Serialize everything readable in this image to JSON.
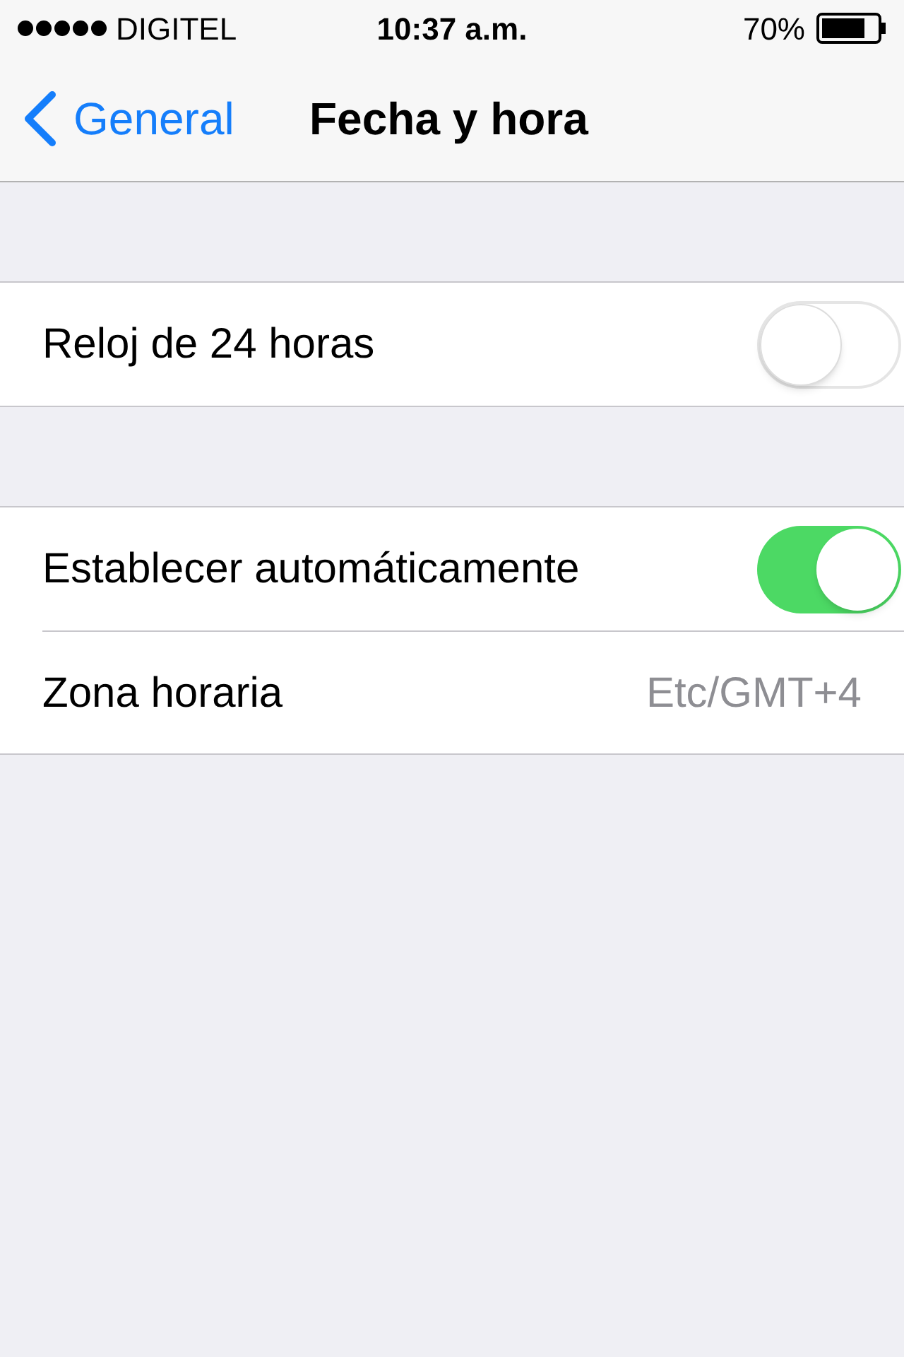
{
  "status_bar": {
    "carrier": "DIGITEL",
    "time": "10:37 a.m.",
    "battery": "70%"
  },
  "nav_bar": {
    "back": "General",
    "title": "Fecha y hora"
  },
  "sections": [
    {
      "rows": [
        {
          "kind": "toggle",
          "label": "Reloj de 24 horas",
          "on": false
        }
      ]
    },
    {
      "rows": [
        {
          "kind": "toggle",
          "label": "Establecer automáticamente",
          "on": true
        },
        {
          "kind": "value",
          "label": "Zona horaria",
          "value": "Etc/GMT+4"
        }
      ]
    }
  ]
}
